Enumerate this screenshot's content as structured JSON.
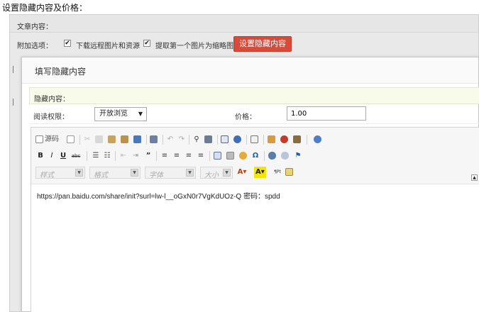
{
  "page": {
    "heading": "设置隐藏内容及价格："
  },
  "panel": {
    "title": "文章内容：",
    "options_label": "附加选项：",
    "option_download": "下载远程图片和资源",
    "option_thumb": "提取第一个图片为缩略图",
    "hidden_button": "设置隐藏内容"
  },
  "dialog": {
    "title": "填写隐藏内容",
    "section_label": "隐藏内容：",
    "read_label": "阅读权限：",
    "read_value": "开放浏览",
    "price_label": "价格：",
    "price_value": "1.00"
  },
  "editor": {
    "source_label": "源码",
    "combo_style": "样式",
    "combo_format": "格式",
    "combo_font": "字体",
    "combo_size": "大小",
    "content": "https://pan.baidu.com/share/init?surl=lw-l__oGxN0r7VgKdUOz-Q   密码：spdd"
  },
  "icons": [
    "source-icon",
    "preview-icon",
    "cut-icon",
    "copy-icon",
    "paste-icon",
    "paste-text-icon",
    "paste-word-icon",
    "print-icon",
    "undo-icon",
    "redo-icon",
    "find-icon",
    "replace-icon",
    "select-all-icon",
    "remove-format-icon",
    "image-icon",
    "flash-icon",
    "media-icon",
    "globe-icon",
    "bold-icon",
    "italic-icon",
    "underline-icon",
    "strike-icon",
    "ordered-list-icon",
    "unordered-list-icon",
    "outdent-icon",
    "indent-icon",
    "blockquote-icon",
    "align-left-icon",
    "align-center-icon",
    "align-right-icon",
    "align-justify-icon",
    "table-icon",
    "hr-icon",
    "smiley-icon",
    "special-char-icon",
    "link-icon",
    "unlink-icon",
    "anchor-icon",
    "text-color-icon",
    "bg-color-icon",
    "maximize-icon",
    "show-blocks-icon"
  ],
  "colors": {
    "button_red": "#d74b3a",
    "section_bg": "#f8fbe9"
  }
}
